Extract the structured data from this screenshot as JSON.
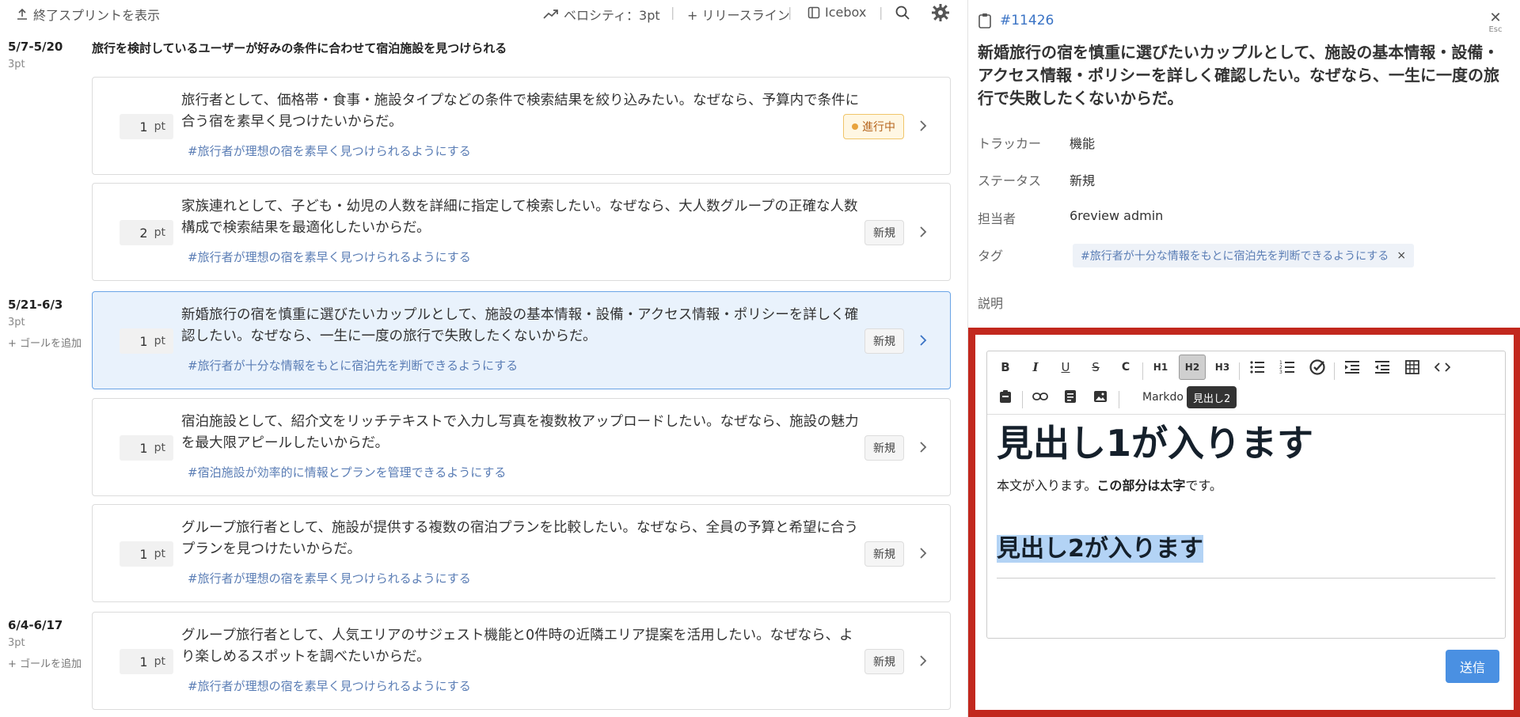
{
  "topbar": {
    "show_finished": "終了スプリントを表示",
    "velocity": "ベロシティ：3pt",
    "release_line": "+ リリースライン",
    "icebox": "Icebox"
  },
  "sprints": [
    {
      "range": "5/7-5/20",
      "pt": "3pt",
      "goal": "",
      "title": "旅行を検討しているユーザーが好みの条件に合わせて宿泊施設を見つけられる"
    },
    {
      "range": "5/21-6/3",
      "pt": "3pt",
      "goal": "+ ゴールを追加"
    },
    {
      "range": "6/4-6/17",
      "pt": "3pt",
      "goal": "+ ゴールを追加"
    }
  ],
  "point_unit": "pt",
  "cards": [
    {
      "points": "1",
      "title": "旅行者として、価格帯・食事・施設タイプなどの条件で検索結果を絞り込みたい。なぜなら、予算内で条件に合う宿を素早く見つけたいからだ。",
      "tag": "#旅行者が理想の宿を素早く見つけられるようにする",
      "status": "進行中"
    },
    {
      "points": "2",
      "title": "家族連れとして、子ども・幼児の人数を詳細に指定して検索したい。なぜなら、大人数グループの正確な人数構成で検索結果を最適化したいからだ。",
      "tag": "#旅行者が理想の宿を素早く見つけられるようにする",
      "status": "新規"
    },
    {
      "points": "1",
      "title": "新婚旅行の宿を慎重に選びたいカップルとして、施設の基本情報・設備・アクセス情報・ポリシーを詳しく確認したい。なぜなら、一生に一度の旅行で失敗したくないからだ。",
      "tag": "#旅行者が十分な情報をもとに宿泊先を判断できるようにする",
      "status": "新規"
    },
    {
      "points": "1",
      "title": "宿泊施設として、紹介文をリッチテキストで入力し写真を複数枚アップロードしたい。なぜなら、施設の魅力を最大限アピールしたいからだ。",
      "tag": "#宿泊施設が効率的に情報とプランを管理できるようにする",
      "status": "新規"
    },
    {
      "points": "1",
      "title": "グループ旅行者として、施設が提供する複数の宿泊プランを比較したい。なぜなら、全員の予算と希望に合うプランを見つけたいからだ。",
      "tag": "#旅行者が理想の宿を素早く見つけられるようにする",
      "status": "新規"
    },
    {
      "points": "1",
      "title": "グループ旅行者として、人気エリアのサジェスト機能と0件時の近隣エリア提案を活用したい。なぜなら、より楽しめるスポットを調べたいからだ。",
      "tag": "#旅行者が理想の宿を素早く見つけられるようにする",
      "status": "新規"
    }
  ],
  "detail": {
    "id": "#11426",
    "esc": "Esc",
    "title": "新婚旅行の宿を慎重に選びたいカップルとして、施設の基本情報・設備・アクセス情報・ポリシーを詳しく確認したい。なぜなら、一生に一度の旅行で失敗したくないからだ。",
    "fields": {
      "tracker_label": "トラッカー",
      "tracker": "機能",
      "status_label": "ステータス",
      "status": "新規",
      "assignee_label": "担当者",
      "assignee": "6review admin",
      "tag_label": "タグ",
      "tag": "#旅行者が十分な情報をもとに宿泊先を判断できるようにする",
      "desc_label": "説明"
    },
    "editor": {
      "markdown": "Markdo",
      "tooltip": "見出し2",
      "h1": "見出し1が入ります",
      "para_plain": "本文が入ります。",
      "para_bold": "この部分は太字",
      "para_end": "です。",
      "h2": "見出し2が入ります",
      "tools": {
        "bold": "B",
        "italic": "I",
        "underline": "U",
        "strike": "S",
        "code": "C",
        "h1": "H1",
        "h2": "H2",
        "h3": "H3"
      }
    },
    "send": "送信"
  },
  "colors": {
    "accent": "#4a90e2",
    "highlight_border": "#c2281e",
    "tag_text": "#5a7db5",
    "active_card": "#e9f2fc"
  }
}
